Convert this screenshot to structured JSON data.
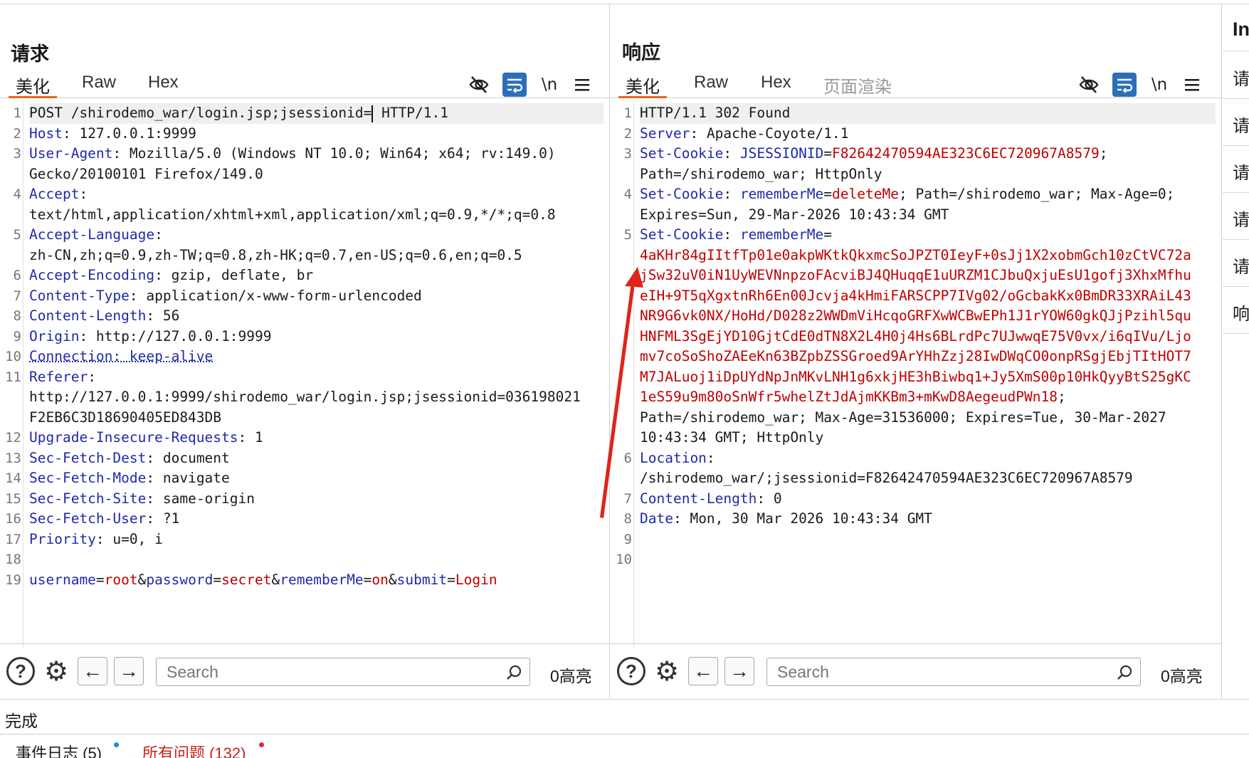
{
  "request": {
    "title": "请求",
    "tabs": [
      "美化",
      "Raw",
      "Hex"
    ],
    "lines": [
      {
        "n": "1",
        "parts": [
          [
            "v",
            "POST /shirodemo_war/login.jsp;jsessionid="
          ],
          [
            "c",
            ""
          ],
          [
            "v",
            " HTTP/1.1"
          ]
        ]
      },
      {
        "n": "2",
        "parts": [
          [
            "k",
            "Host"
          ],
          [
            "v",
            ": 127.0.0.1:9999"
          ]
        ]
      },
      {
        "n": "3",
        "parts": [
          [
            "k",
            "User-Agent"
          ],
          [
            "v",
            ": Mozilla/5.0 (Windows NT 10.0; Win64; x64; rv:149.0)"
          ]
        ]
      },
      {
        "n": "",
        "parts": [
          [
            "v",
            "Gecko/20100101 Firefox/149.0"
          ]
        ]
      },
      {
        "n": "4",
        "parts": [
          [
            "k",
            "Accept"
          ],
          [
            "v",
            ":"
          ]
        ]
      },
      {
        "n": "",
        "parts": [
          [
            "v",
            "text/html,application/xhtml+xml,application/xml;q=0.9,*/*;q=0.8"
          ]
        ]
      },
      {
        "n": "5",
        "parts": [
          [
            "k",
            "Accept-Language"
          ],
          [
            "v",
            ":"
          ]
        ]
      },
      {
        "n": "",
        "parts": [
          [
            "v",
            "zh-CN,zh;q=0.9,zh-TW;q=0.8,zh-HK;q=0.7,en-US;q=0.6,en;q=0.5"
          ]
        ]
      },
      {
        "n": "6",
        "parts": [
          [
            "k",
            "Accept-Encoding"
          ],
          [
            "v",
            ": gzip, deflate, br"
          ]
        ]
      },
      {
        "n": "7",
        "parts": [
          [
            "k",
            "Content-Type"
          ],
          [
            "v",
            ": application/x-www-form-urlencoded"
          ]
        ]
      },
      {
        "n": "8",
        "parts": [
          [
            "k",
            "Content-Length"
          ],
          [
            "v",
            ": 56"
          ]
        ]
      },
      {
        "n": "9",
        "parts": [
          [
            "k",
            "Origin"
          ],
          [
            "v",
            ": http://127.0.0.1:9999"
          ]
        ]
      },
      {
        "n": "10",
        "parts": [
          [
            "d",
            "Connection: keep-alive"
          ]
        ]
      },
      {
        "n": "11",
        "parts": [
          [
            "k",
            "Referer"
          ],
          [
            "v",
            ":"
          ]
        ]
      },
      {
        "n": "",
        "parts": [
          [
            "v",
            "http://127.0.0.1:9999/shirodemo_war/login.jsp;jsessionid=036198021"
          ]
        ]
      },
      {
        "n": "",
        "parts": [
          [
            "v",
            "F2EB6C3D18690405ED843DB"
          ]
        ]
      },
      {
        "n": "12",
        "parts": [
          [
            "k",
            "Upgrade-Insecure-Requests"
          ],
          [
            "v",
            ": 1"
          ]
        ]
      },
      {
        "n": "13",
        "parts": [
          [
            "k",
            "Sec-Fetch-Dest"
          ],
          [
            "v",
            ": document"
          ]
        ]
      },
      {
        "n": "14",
        "parts": [
          [
            "k",
            "Sec-Fetch-Mode"
          ],
          [
            "v",
            ": navigate"
          ]
        ]
      },
      {
        "n": "15",
        "parts": [
          [
            "k",
            "Sec-Fetch-Site"
          ],
          [
            "v",
            ": same-origin"
          ]
        ]
      },
      {
        "n": "16",
        "parts": [
          [
            "k",
            "Sec-Fetch-User"
          ],
          [
            "v",
            ": ?1"
          ]
        ]
      },
      {
        "n": "17",
        "parts": [
          [
            "k",
            "Priority"
          ],
          [
            "v",
            ": u=0, i"
          ]
        ]
      },
      {
        "n": "18",
        "parts": [
          [
            "v",
            ""
          ]
        ]
      },
      {
        "n": "19",
        "parts": [
          [
            "k",
            "username"
          ],
          [
            "v",
            "="
          ],
          [
            "r",
            "root"
          ],
          [
            "v",
            "&"
          ],
          [
            "k",
            "password"
          ],
          [
            "v",
            "="
          ],
          [
            "r",
            "secret"
          ],
          [
            "v",
            "&"
          ],
          [
            "k",
            "rememberMe"
          ],
          [
            "v",
            "="
          ],
          [
            "r",
            "on"
          ],
          [
            "v",
            "&"
          ],
          [
            "k",
            "submit"
          ],
          [
            "v",
            "="
          ],
          [
            "r",
            "Login"
          ]
        ]
      }
    ],
    "search_placeholder": "Search",
    "highlight_count": "0高亮"
  },
  "response": {
    "title": "响应",
    "tabs": [
      "美化",
      "Raw",
      "Hex",
      "页面渲染"
    ],
    "lines": [
      {
        "n": "1",
        "parts": [
          [
            "v",
            "HTTP/1.1 302 Found"
          ]
        ]
      },
      {
        "n": "2",
        "parts": [
          [
            "k",
            "Server"
          ],
          [
            "v",
            ": Apache-Coyote/1.1"
          ]
        ]
      },
      {
        "n": "3",
        "parts": [
          [
            "k",
            "Set-Cookie"
          ],
          [
            "v",
            ": "
          ],
          [
            "k",
            "JSESSIONID"
          ],
          [
            "v",
            "="
          ],
          [
            "r",
            "F82642470594AE323C6EC720967A8579"
          ],
          [
            "v",
            ";"
          ]
        ]
      },
      {
        "n": "",
        "parts": [
          [
            "v",
            "Path=/shirodemo_war; HttpOnly"
          ]
        ]
      },
      {
        "n": "4",
        "parts": [
          [
            "k",
            "Set-Cookie"
          ],
          [
            "v",
            ": "
          ],
          [
            "k",
            "rememberMe"
          ],
          [
            "v",
            "="
          ],
          [
            "r",
            "deleteMe"
          ],
          [
            "v",
            "; Path=/shirodemo_war; Max-Age=0;"
          ]
        ]
      },
      {
        "n": "",
        "parts": [
          [
            "v",
            "Expires=Sun, 29-Mar-2026 10:43:34 GMT"
          ]
        ]
      },
      {
        "n": "5",
        "parts": [
          [
            "k",
            "Set-Cookie"
          ],
          [
            "v",
            ": "
          ],
          [
            "k",
            "rememberMe"
          ],
          [
            "v",
            "="
          ]
        ]
      },
      {
        "n": "",
        "parts": [
          [
            "r",
            "4aKHr84gIItfTp01e0akpWKtkQkxmcSoJPZT0IeyF+0sJj1X2xobmGch10zCtVC72a"
          ]
        ]
      },
      {
        "n": "",
        "parts": [
          [
            "r",
            "jSw32uV0iN1UyWEVNnpzoFAcviBJ4QHuqqE1uURZM1CJbuQxjuEsU1gofj3XhxMfhu"
          ]
        ]
      },
      {
        "n": "",
        "parts": [
          [
            "r",
            "eIH+9T5qXgxtnRh6En00Jcvja4kHmiFARSCPP7IVg02/oGcbakKx0BmDR33XRAiL43"
          ]
        ]
      },
      {
        "n": "",
        "parts": [
          [
            "r",
            "NR9G6vk0NX/HoHd/D028z2WWDmViHcqoGRFXwWCBwEPh1J1rYOW60gkQJjPzihl5qu"
          ]
        ]
      },
      {
        "n": "",
        "parts": [
          [
            "r",
            "HNFML3SgEjYD10GjtCdE0dTN8X2L4H0j4Hs6BLrdPc7UJwwqE75V0vx/i6qIVu/Ljo"
          ]
        ]
      },
      {
        "n": "",
        "parts": [
          [
            "r",
            "mv7coSoShoZAEeKn63BZpbZSSGroed9ArYHhZzj28IwDWqCO0onpRSgjEbjTItHOT7"
          ]
        ]
      },
      {
        "n": "",
        "parts": [
          [
            "r",
            "M7JALuoj1iDpUYdNpJnMKvLNH1g6xkjHE3hBiwbq1+Jy5XmS00p10HkQyyBtS25gKC"
          ]
        ]
      },
      {
        "n": "",
        "parts": [
          [
            "r",
            "1eS59u9m80oSnWfr5whelZtJdAjmKKBm3+mKwD8AegeudPWn18"
          ],
          [
            "v",
            ";"
          ]
        ]
      },
      {
        "n": "",
        "parts": [
          [
            "v",
            "Path=/shirodemo_war; Max-Age=31536000; Expires=Tue, 30-Mar-2027"
          ]
        ]
      },
      {
        "n": "",
        "parts": [
          [
            "v",
            "10:43:34 GMT; HttpOnly"
          ]
        ]
      },
      {
        "n": "6",
        "parts": [
          [
            "k",
            "Location"
          ],
          [
            "v",
            ":"
          ]
        ]
      },
      {
        "n": "",
        "parts": [
          [
            "v",
            "/shirodemo_war/;jsessionid=F82642470594AE323C6EC720967A8579"
          ]
        ]
      },
      {
        "n": "7",
        "parts": [
          [
            "k",
            "Content-Length"
          ],
          [
            "v",
            ": 0"
          ]
        ]
      },
      {
        "n": "8",
        "parts": [
          [
            "k",
            "Date"
          ],
          [
            "v",
            ": Mon, 30 Mar 2026 10:43:34 GMT"
          ]
        ]
      },
      {
        "n": "9",
        "parts": [
          [
            "v",
            ""
          ]
        ]
      },
      {
        "n": "10",
        "parts": [
          [
            "v",
            ""
          ]
        ]
      }
    ],
    "search_placeholder": "Search",
    "highlight_count": "0高亮"
  },
  "right_panel": {
    "title": "In",
    "items": [
      "请",
      "请",
      "请",
      "请",
      "请",
      "响"
    ]
  },
  "status": "完成",
  "footer": {
    "event_log": "事件日志 (5)",
    "all_issues": "所有问题 (132)"
  },
  "colors": {
    "accent_blue": "#2c6fb8",
    "tab_underline": "#e8671b",
    "header_key": "#1f2aa8",
    "value_red": "#c00000",
    "arrow_red": "#e0241b",
    "dot_blue": "#1e88e5",
    "dot_red": "#e0243b"
  }
}
